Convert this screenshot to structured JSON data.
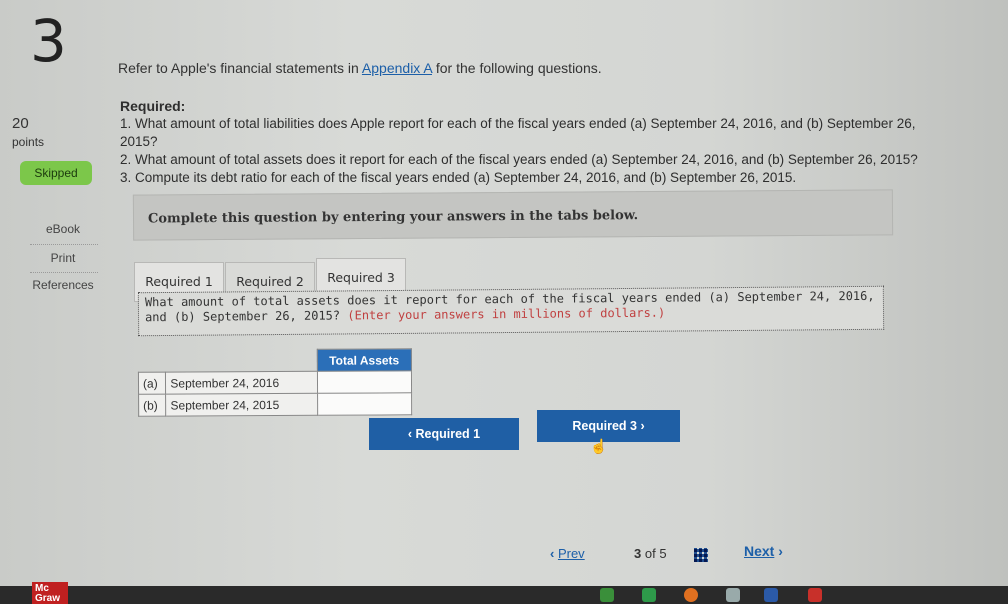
{
  "question_number": "3",
  "points": {
    "value": "20",
    "label": "points"
  },
  "status_badge": "Skipped",
  "sidebar": {
    "items": [
      "eBook",
      "Print",
      "References"
    ]
  },
  "intro": {
    "before": "Refer to Apple's financial statements in ",
    "link": "Appendix A",
    "after": " for the following questions."
  },
  "required": {
    "heading": "Required:",
    "items": [
      "1. What amount of total liabilities does Apple report for each of the fiscal years ended (a) September 24, 2016, and (b) September 26, 2015?",
      "2. What amount of total assets does it report for each of the fiscal years ended (a) September 24, 2016, and (b) September 26, 2015?",
      "3. Compute its debt ratio for each of the fiscal years ended (a) September 24, 2016, and (b) September 26, 2015."
    ]
  },
  "banner": "Complete this question by entering your answers in the tabs below.",
  "tabs": [
    "Required 1",
    "Required 2",
    "Required 3"
  ],
  "question": {
    "text": "What amount of total assets does it report for each of the fiscal years ended (a) September 24, 2016, and (b) September 26, 2015?",
    "hint": "(Enter your answers in millions of dollars.)"
  },
  "table": {
    "header": "Total Assets",
    "rows": [
      {
        "label": "(a)",
        "date": "September 24, 2016",
        "value": ""
      },
      {
        "label": "(b)",
        "date": "September 24, 2015",
        "value": ""
      }
    ]
  },
  "nav": {
    "prev": "‹  Required 1",
    "next": "Required 3  ›"
  },
  "pager": {
    "prev": "Prev",
    "current": "3",
    "of": "of 5",
    "next": "Next"
  },
  "logo": "Mc Graw"
}
